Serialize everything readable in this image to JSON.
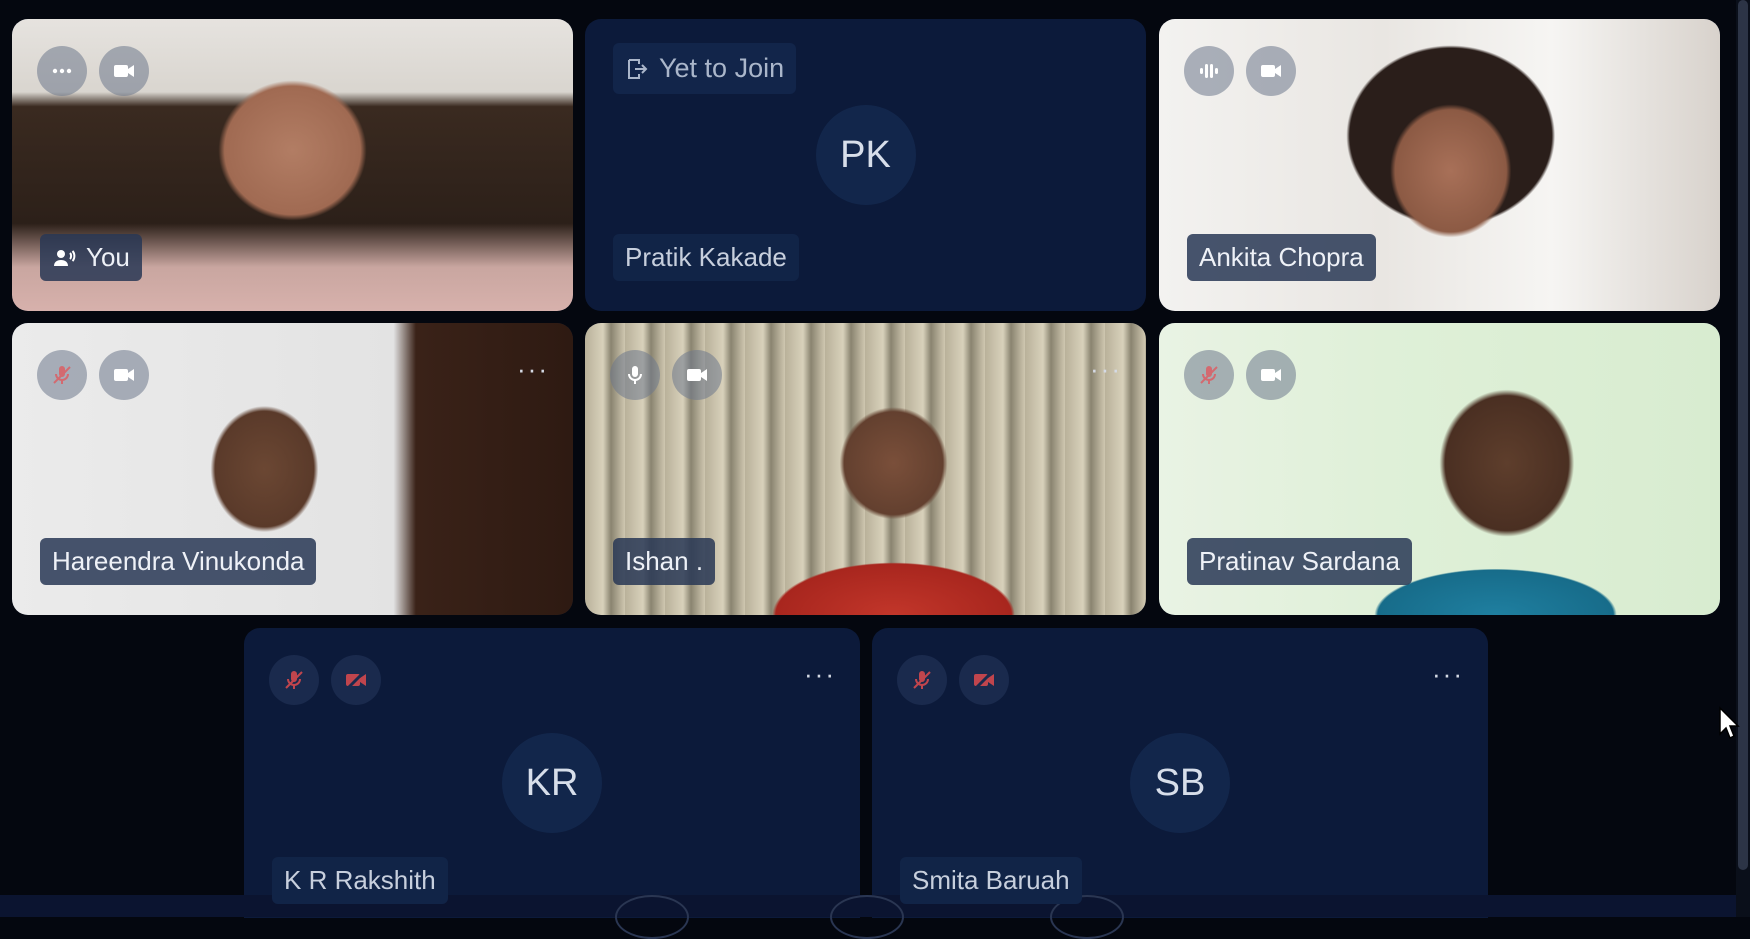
{
  "tiles": {
    "you": {
      "name": "You"
    },
    "pratik": {
      "status": "Yet to Join",
      "initials": "PK",
      "name": "Pratik Kakade"
    },
    "ankita": {
      "name": "Ankita Chopra"
    },
    "hareendra": {
      "name": "Hareendra Vinukonda"
    },
    "ishan": {
      "name": "Ishan ."
    },
    "pratinav": {
      "name": "Pratinav Sardana"
    },
    "rakshith": {
      "initials": "KR",
      "name": "K R Rakshith"
    },
    "smita": {
      "initials": "SB",
      "name": "Smita Baruah"
    }
  },
  "colors": {
    "background": "#04070f",
    "tile_dark": "#0c1a3a",
    "muted_red": "#c0454d"
  },
  "icons": [
    "more-icon",
    "camera-icon",
    "speaker-icon",
    "audio-wave-icon",
    "mic-muted-icon",
    "mic-icon",
    "camera-off-icon",
    "leave-icon"
  ]
}
